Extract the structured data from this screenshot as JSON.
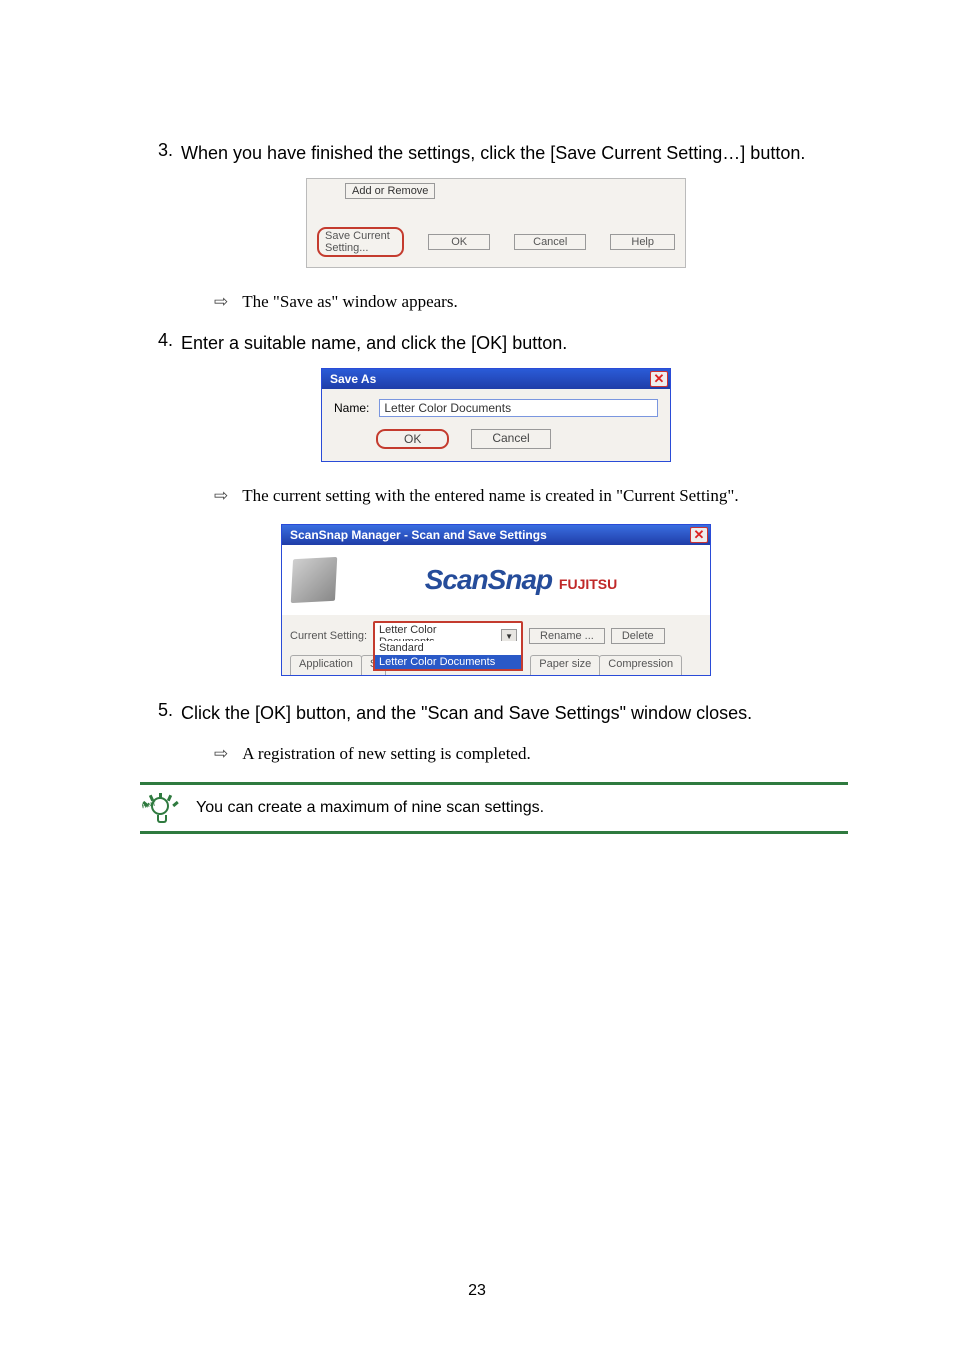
{
  "step3": {
    "num": "3.",
    "text": "When you have finished the settings, click the [Save Current Setting…] button."
  },
  "dlg1": {
    "add_remove": "Add or Remove",
    "save_current": "Save Current Setting...",
    "ok": "OK",
    "cancel": "Cancel",
    "help": "Help"
  },
  "note1": {
    "arrow": "⇨",
    "text": "The \"Save as\" window appears."
  },
  "step4": {
    "num": "4.",
    "text": "Enter a suitable name, and click the [OK] button."
  },
  "dlg2": {
    "title": "Save As",
    "name_label": "Name:",
    "name_value": "Letter Color Documents",
    "ok": "OK",
    "cancel": "Cancel"
  },
  "note2": {
    "arrow": "⇨",
    "text": "The current setting with the entered name is created in \"Current Setting\"."
  },
  "dlg3": {
    "title": "ScanSnap Manager - Scan and Save Settings",
    "logo": "ScanSnap",
    "brand": "FUJITSU",
    "current_label": "Current Setting:",
    "current_value": "Letter Color Documents",
    "rename": "Rename ...",
    "delete": "Delete",
    "options": {
      "0": "Standard",
      "1": "Letter Color Documents"
    },
    "tabs": {
      "0": "Application",
      "1": "Sa",
      "2": "Paper size",
      "3": "Compression"
    }
  },
  "step5": {
    "num": "5.",
    "text": "Click the [OK] button, and the \"Scan and Save Settings\" window closes."
  },
  "note3": {
    "arrow": "⇨",
    "text": "A registration of new setting is completed."
  },
  "hint": {
    "text": "You can create a maximum of nine scan settings."
  },
  "page_number": "23"
}
